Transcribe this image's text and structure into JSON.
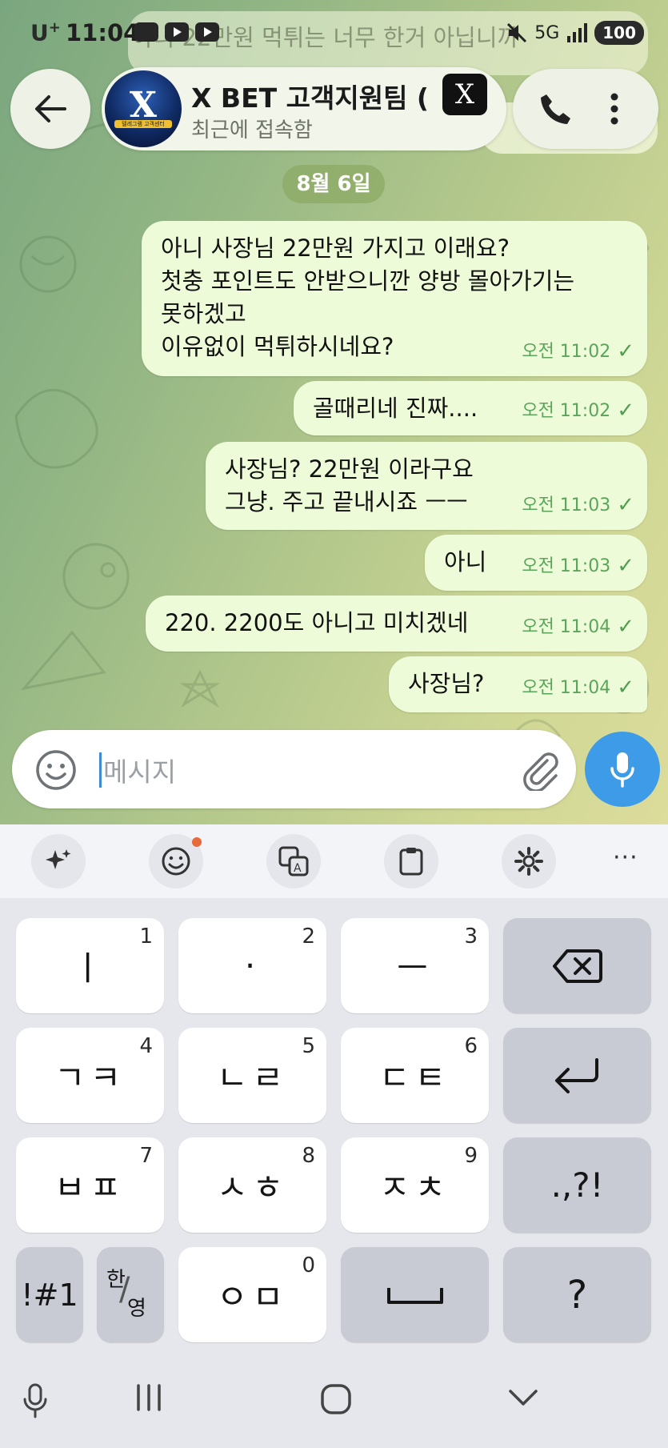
{
  "status_bar": {
    "carrier": "U",
    "carrier_sup": "+",
    "time": "11:04",
    "battery": "100",
    "network": "5G"
  },
  "background_preview": {
    "message_fragment": "아니 22만원 먹튀는 너무 한거 아닙니까"
  },
  "header": {
    "channel_name": "X BET 고객지원팀 (",
    "status": "최근에 접속함",
    "avatar_letter": "X",
    "avatar_caption": "텔레그램 고객센터",
    "badge_letter": "X"
  },
  "date_chip": "8월 6일",
  "messages": [
    {
      "text": "아니 사장님 22만원 가지고 이래요?\n첫충 포인트도 안받으니깐 양방 몰아가기는\n못하겠고\n이유없이 먹튀하시네요?",
      "time": "오전 11:02",
      "status": "✓"
    },
    {
      "text": "골때리네 진짜....",
      "time": "오전 11:02",
      "status": "✓"
    },
    {
      "text": "사장님? 22만원 이라구요\n그냥. 주고 끝내시죠 ㅡㅡ",
      "time": "오전 11:03",
      "status": "✓"
    },
    {
      "text": "아니",
      "time": "오전 11:03",
      "status": "✓"
    },
    {
      "text": "220. 2200도 아니고 미치겠네",
      "time": "오전 11:04",
      "status": "✓"
    },
    {
      "text": "사장님?",
      "time": "오전 11:04",
      "status": "✓"
    }
  ],
  "input": {
    "placeholder": "메시지"
  },
  "keyboard": {
    "toolbar_more": "···",
    "rows": [
      [
        {
          "label": "ㅣ",
          "num": "1"
        },
        {
          "label": "·",
          "num": "2"
        },
        {
          "label": "ㅡ",
          "num": "3"
        },
        {
          "label": "backspace-icon"
        }
      ],
      [
        {
          "label": "ㄱㅋ",
          "num": "4"
        },
        {
          "label": "ㄴㄹ",
          "num": "5"
        },
        {
          "label": "ㄷㅌ",
          "num": "6"
        },
        {
          "label": "enter-icon"
        }
      ],
      [
        {
          "label": "ㅂㅍ",
          "num": "7"
        },
        {
          "label": "ㅅㅎ",
          "num": "8"
        },
        {
          "label": "ㅈㅊ",
          "num": "9"
        },
        {
          "label": ".,?!"
        }
      ],
      [
        {
          "label": "!#1"
        },
        {
          "label_a": "한",
          "label_b": "영"
        },
        {
          "label": "ㅇㅁ",
          "num": "0"
        },
        {
          "label": "space-icon"
        },
        {
          "label": "?"
        }
      ]
    ]
  },
  "colors": {
    "bubble": "#eefbd9",
    "check": "#4fa04f",
    "accent": "#3e9be8"
  }
}
